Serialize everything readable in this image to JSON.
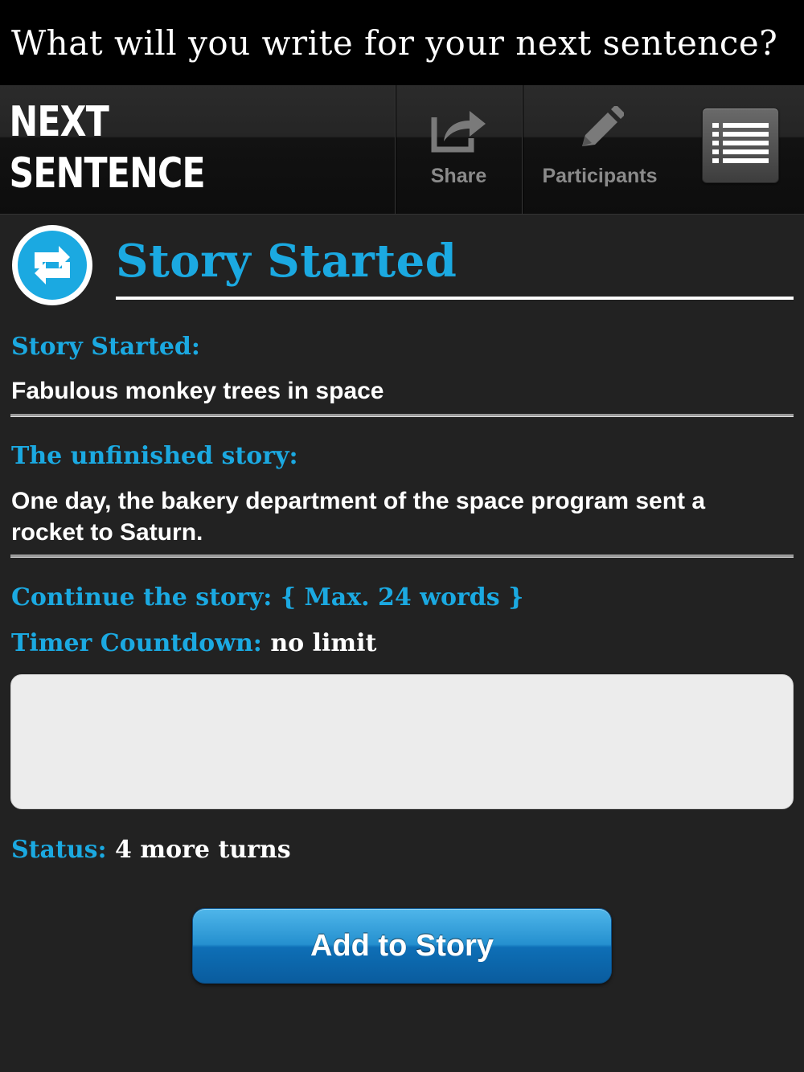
{
  "banner": {
    "question": "What will you write for your next sentence?"
  },
  "navbar": {
    "brand_line1": "NEXT",
    "brand_line2": "SENTENCE",
    "share_label": "Share",
    "participants_label": "Participants"
  },
  "page": {
    "title": "Story Started",
    "accent_color": "#1ba9e1"
  },
  "story": {
    "started_label": "Story Started:",
    "started_value": "Fabulous monkey trees in space",
    "unfinished_label": "The unfinished story:",
    "unfinished_value": "One day, the bakery department of the space program sent a rocket to Saturn.",
    "continue_label": "Continue the story: { Max. 24 words }",
    "timer_label": "Timer Countdown:",
    "timer_value": "no limit",
    "entry_value": "",
    "entry_placeholder": "",
    "status_label": "Status:",
    "status_value": "4 more turns"
  },
  "actions": {
    "add_label": "Add to Story"
  },
  "icons": {
    "share": "share-icon",
    "participants": "pencil-icon",
    "menu": "list-menu-icon",
    "story": "refresh-arrows-icon"
  }
}
